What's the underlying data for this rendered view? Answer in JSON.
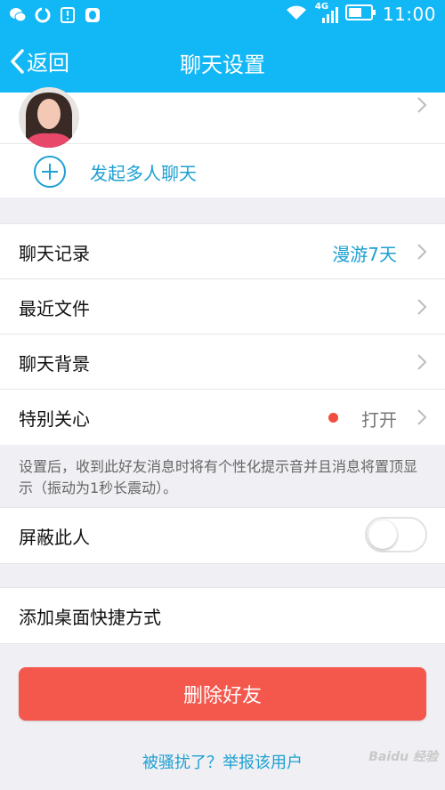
{
  "status_bar": {
    "network": "4G",
    "time": "11:00"
  },
  "nav": {
    "back_label": "返回",
    "title": "聊天设置"
  },
  "profile": {
    "start_group_chat": "发起多人聊天"
  },
  "settings": {
    "chat_history": {
      "label": "聊天记录",
      "value": "漫游7天"
    },
    "recent_files": {
      "label": "最近文件"
    },
    "chat_background": {
      "label": "聊天背景"
    },
    "special_care": {
      "label": "特别关心",
      "value": "打开"
    },
    "special_care_hint": "设置后，收到此好友消息时将有个性化提示音并且消息将置顶显示（振动为1秒长震动）。",
    "block_person": {
      "label": "屏蔽此人",
      "enabled": false
    },
    "add_shortcut": "添加桌面快捷方式"
  },
  "actions": {
    "delete_friend": "删除好友",
    "report_user": "被骚扰了？举报该用户"
  },
  "watermark": "Baidu 经验",
  "colors": {
    "brand": "#12b7f5",
    "link": "#1ea0d2",
    "danger": "#f4584d",
    "dot": "#f04d3e"
  }
}
